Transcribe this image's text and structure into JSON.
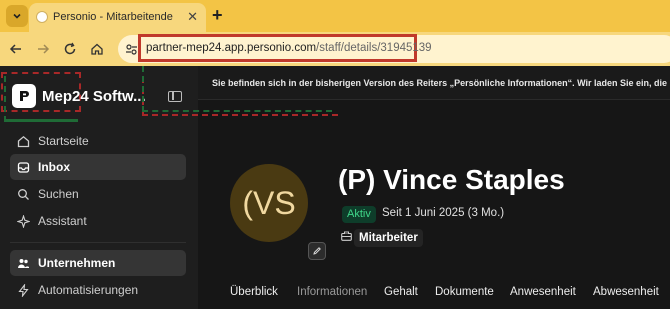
{
  "browser": {
    "tab_title": "Personio - Mitarbeitende",
    "new_tab_label": "+",
    "url_host": "partner-mep24.app.personio.com",
    "url_path": "/staff/details/31945139"
  },
  "sidebar": {
    "brand_name": "Mep24 Softw...",
    "items": [
      {
        "label": "Startseite",
        "icon": "home-icon"
      },
      {
        "label": "Inbox",
        "icon": "inbox-icon"
      },
      {
        "label": "Suchen",
        "icon": "search-icon"
      },
      {
        "label": "Assistant",
        "icon": "assistant-icon"
      },
      {
        "label": "Unternehmen",
        "icon": "people-icon"
      },
      {
        "label": "Automatisierungen",
        "icon": "automation-icon"
      }
    ]
  },
  "main": {
    "banner": "Sie befinden sich in der bisherigen Version des Reiters „Persönliche Informationen“. Wir laden Sie ein, die",
    "profile": {
      "initials": "(VS",
      "name": "(P) Vince Staples",
      "status": "Aktiv",
      "since": "Seit 1 Juni 2025 (3 Mo.)",
      "role": "Mitarbeiter"
    },
    "tabs": [
      "Überblick",
      "Informationen",
      "Gehalt",
      "Dokumente",
      "Anwesenheit",
      "Abwesenheit"
    ]
  },
  "colors": {
    "chrome_yellow": "#f3c445",
    "annotation_red": "#c0392b",
    "annotation_green": "#1f6b36",
    "status_green": "#40d68a"
  }
}
